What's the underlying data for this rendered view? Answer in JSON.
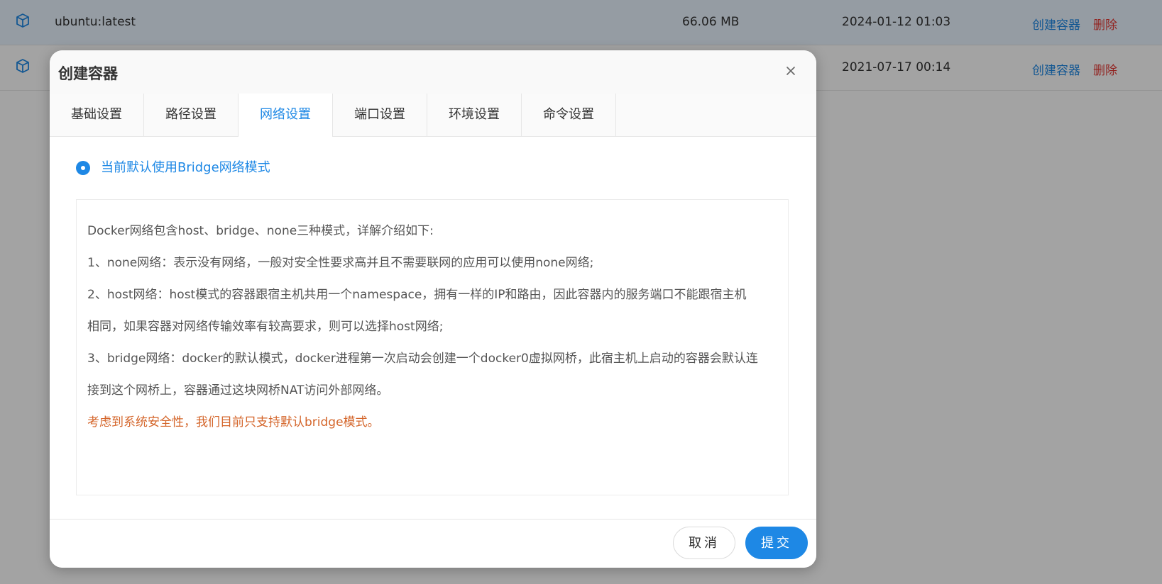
{
  "image_list": {
    "rows": [
      {
        "icon": "box-icon",
        "name": "ubuntu:latest",
        "size": "66.06 MB",
        "created": "2024-01-12 01:03",
        "create_label": "创建容器",
        "delete_label": "删除"
      },
      {
        "icon": "box-icon",
        "name": "",
        "size": "",
        "created": "2021-07-17 00:14",
        "create_label": "创建容器",
        "delete_label": "删除"
      }
    ]
  },
  "dialog": {
    "title": "创建容器",
    "close_icon": "close-icon",
    "tabs": [
      {
        "label": "基础设置"
      },
      {
        "label": "路径设置"
      },
      {
        "label": "网络设置"
      },
      {
        "label": "端口设置"
      },
      {
        "label": "环境设置"
      },
      {
        "label": "命令设置"
      }
    ],
    "active_tab": "网络设置",
    "network": {
      "radio_label": "当前默认使用Bridge网络模式",
      "lines": [
        "Docker网络包含host、bridge、none三种模式，详解介绍如下:",
        "1、none网络：表示没有网络，一般对安全性要求高并且不需要联网的应用可以使用none网络;",
        "2、host网络：host模式的容器跟宿主机共用一个namespace，拥有一样的IP和路由，因此容器内的服务端口不能跟宿主机",
        "相同，如果容器对网络传输效率有较高要求，则可以选择host网络;",
        "3、bridge网络：docker的默认模式，docker进程第一次启动会创建一个docker0虚拟网桥，此宿主机上启动的容器会默认连",
        "接到这个网桥上，容器通过这块网桥NAT访问外部网络。"
      ],
      "warning": "考虑到系统安全性，我们目前只支持默认bridge模式。"
    },
    "footer": {
      "cancel_label": "取消",
      "submit_label": "提交"
    }
  },
  "colors": {
    "accent": "#1e88e5",
    "danger": "#e53935",
    "warning": "#d4652a"
  }
}
